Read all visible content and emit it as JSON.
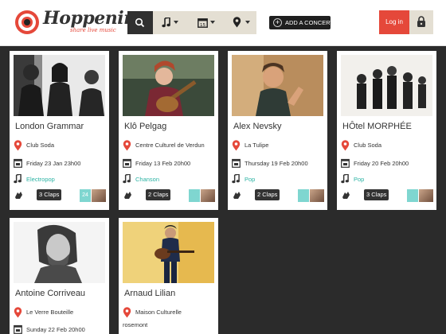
{
  "header": {
    "brand": "Hoppening",
    "tagline": "share live music",
    "search_icon": "search-icon",
    "filters": [
      {
        "icon": "music-note-icon"
      },
      {
        "icon": "calendar-icon",
        "day": "15"
      },
      {
        "icon": "location-pin-icon"
      }
    ],
    "add_concert_label": "ADD A CONCERT",
    "login_label": "Log in",
    "lock_icon": "lock-icon",
    "accent_color": "#e5483a"
  },
  "concerts": [
    {
      "artist": "London Grammar",
      "venue": "Club Soda",
      "date": "Friday 23 Jan 23h00",
      "genre": "Electropop",
      "claps": "3 Claps",
      "user_count": "24"
    },
    {
      "artist": "Klô Pelgag",
      "venue": "Centre Culturel de Verdun",
      "date": "Friday 13 Feb 20h00",
      "genre": "Chanson",
      "claps": "2 Claps",
      "user_count": ""
    },
    {
      "artist": "Alex Nevsky",
      "venue": "La Tulipe",
      "date": "Thursday 19 Feb 20h00",
      "genre": "Pop",
      "claps": "2 Claps",
      "user_count": ""
    },
    {
      "artist": "HÔtel MORPHÉE",
      "venue": "Club Soda",
      "date": "Friday 20 Feb 20h00",
      "genre": "Pop",
      "claps": "3 Claps",
      "user_count": ""
    },
    {
      "artist": "Antoine Corriveau",
      "venue": "Le Verre Bouteille",
      "date": "Sunday 22 Feb 20h00"
    },
    {
      "artist": "Arnaud Lilian",
      "venue": "Maison Culturelle",
      "venue_line2": "rosemont"
    }
  ]
}
